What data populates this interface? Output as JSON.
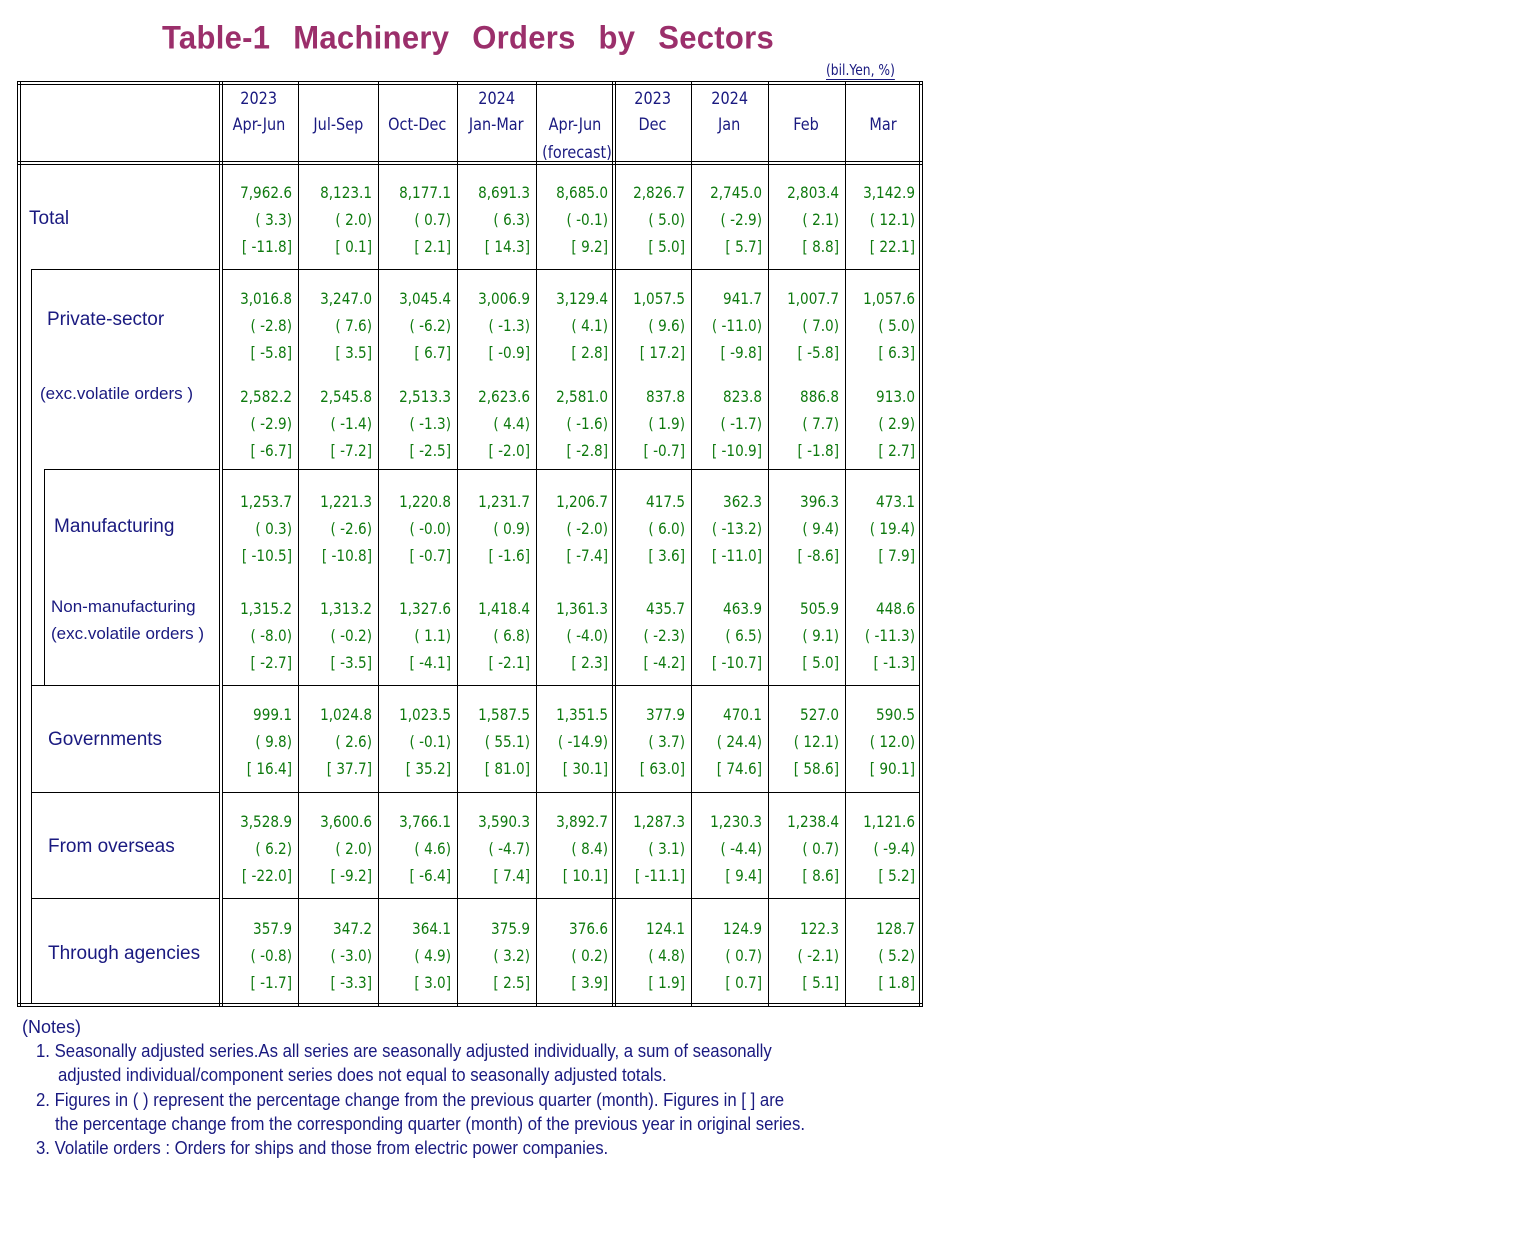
{
  "title": "Table-1  Machinery  Orders  by  Sectors",
  "unit": "(bil.Yen, %)",
  "header": {
    "columns": [
      {
        "year": "2023",
        "period": "Apr-Jun",
        "note": ""
      },
      {
        "year": "",
        "period": "Jul-Sep",
        "note": ""
      },
      {
        "year": "",
        "period": "Oct-Dec",
        "note": ""
      },
      {
        "year": "2024",
        "period": "Jan-Mar",
        "note": ""
      },
      {
        "year": "",
        "period": "Apr-Jun",
        "note": "(forecast)"
      },
      {
        "year": "2023",
        "period": "Dec",
        "note": ""
      },
      {
        "year": "2024",
        "period": "Jan",
        "note": ""
      },
      {
        "year": "",
        "period": "Feb",
        "note": ""
      },
      {
        "year": "",
        "period": "Mar",
        "note": ""
      }
    ]
  },
  "rows": [
    {
      "label": "Total",
      "sublabel": "",
      "values": [
        "7,962.6",
        "8,123.1",
        "8,177.1",
        "8,691.3",
        "8,685.0",
        "2,826.7",
        "2,745.0",
        "2,803.4",
        "3,142.9"
      ],
      "qoq": [
        "( 3.3)",
        "( 2.0)",
        "( 0.7)",
        "( 6.3)",
        "( -0.1)",
        "( 5.0)",
        "( -2.9)",
        "( 2.1)",
        "( 12.1)"
      ],
      "yoy": [
        "[ -11.8]",
        "[ 0.1]",
        "[ 2.1]",
        "[ 14.3]",
        "[ 9.2]",
        "[ 5.0]",
        "[ 5.7]",
        "[ 8.8]",
        "[ 22.1]"
      ]
    },
    {
      "label": "Private-sector",
      "sublabel": "",
      "values": [
        "3,016.8",
        "3,247.0",
        "3,045.4",
        "3,006.9",
        "3,129.4",
        "1,057.5",
        "941.7",
        "1,007.7",
        "1,057.6"
      ],
      "qoq": [
        "( -2.8)",
        "(  7.6)",
        "( -6.2)",
        "( -1.3)",
        "(  4.1)",
        "(  9.6)",
        "( -11.0)",
        "(  7.0)",
        "(  5.0)"
      ],
      "yoy": [
        "[ -5.8]",
        "[  3.5]",
        "[  6.7]",
        "[ -0.9]",
        "[  2.8]",
        "[  17.2]",
        "[ -9.8]",
        "[ -5.8]",
        "[  6.3]"
      ]
    },
    {
      "label": "(exc.volatile orders )",
      "sublabel": "",
      "values": [
        "2,582.2",
        "2,545.8",
        "2,513.3",
        "2,623.6",
        "2,581.0",
        "837.8",
        "823.8",
        "886.8",
        "913.0"
      ],
      "qoq": [
        "( -2.9)",
        "( -1.4)",
        "( -1.3)",
        "( 4.4)",
        "( -1.6)",
        "( 1.9)",
        "( -1.7)",
        "( 7.7)",
        "( 2.9)"
      ],
      "yoy": [
        "[ -6.7]",
        "[ -7.2]",
        "[ -2.5]",
        "[ -2.0]",
        "[ -2.8]",
        "[ -0.7]",
        "[ -10.9]",
        "[ -1.8]",
        "[ 2.7]"
      ]
    },
    {
      "label": "Manufacturing",
      "sublabel": "",
      "values": [
        "1,253.7",
        "1,221.3",
        "1,220.8",
        "1,231.7",
        "1,206.7",
        "417.5",
        "362.3",
        "396.3",
        "473.1"
      ],
      "qoq": [
        "( 0.3)",
        "( -2.6)",
        "( -0.0)",
        "( 0.9)",
        "( -2.0)",
        "( 6.0)",
        "( -13.2)",
        "( 9.4)",
        "( 19.4)"
      ],
      "yoy": [
        "[ -10.5]",
        "[ -10.8]",
        "[ -0.7]",
        "[ -1.6]",
        "[ -7.4]",
        "[ 3.6]",
        "[ -11.0]",
        "[ -8.6]",
        "[ 7.9]"
      ]
    },
    {
      "label": "Non-manufacturing",
      "sublabel": "(exc.volatile orders )",
      "values": [
        "1,315.2",
        "1,313.2",
        "1,327.6",
        "1,418.4",
        "1,361.3",
        "435.7",
        "463.9",
        "505.9",
        "448.6"
      ],
      "qoq": [
        "( -8.0)",
        "( -0.2)",
        "( 1.1)",
        "( 6.8)",
        "( -4.0)",
        "( -2.3)",
        "( 6.5)",
        "( 9.1)",
        "( -11.3)"
      ],
      "yoy": [
        "[ -2.7]",
        "[ -3.5]",
        "[ -4.1]",
        "[ -2.1]",
        "[ 2.3]",
        "[ -4.2]",
        "[ -10.7]",
        "[ 5.0]",
        "[ -1.3]"
      ]
    },
    {
      "label": "Governments",
      "sublabel": "",
      "values": [
        "999.1",
        "1,024.8",
        "1,023.5",
        "1,587.5",
        "1,351.5",
        "377.9",
        "470.1",
        "527.0",
        "590.5"
      ],
      "qoq": [
        "( 9.8)",
        "( 2.6)",
        "( -0.1)",
        "( 55.1)",
        "( -14.9)",
        "( 3.7)",
        "( 24.4)",
        "( 12.1)",
        "( 12.0)"
      ],
      "yoy": [
        "[ 16.4]",
        "[ 37.7]",
        "[ 35.2]",
        "[ 81.0]",
        "[ 30.1]",
        "[ 63.0]",
        "[ 74.6]",
        "[ 58.6]",
        "[ 90.1]"
      ]
    },
    {
      "label": "From overseas",
      "sublabel": "",
      "values": [
        "3,528.9",
        "3,600.6",
        "3,766.1",
        "3,590.3",
        "3,892.7",
        "1,287.3",
        "1,230.3",
        "1,238.4",
        "1,121.6"
      ],
      "qoq": [
        "( 6.2)",
        "( 2.0)",
        "( 4.6)",
        "( -4.7)",
        "( 8.4)",
        "( 3.1)",
        "( -4.4)",
        "( 0.7)",
        "( -9.4)"
      ],
      "yoy": [
        "[ -22.0]",
        "[ -9.2]",
        "[ -6.4]",
        "[ 7.4]",
        "[ 10.1]",
        "[ -11.1]",
        "[ 9.4]",
        "[ 8.6]",
        "[ 5.2]"
      ]
    },
    {
      "label": "Through agencies",
      "sublabel": "",
      "values": [
        "357.9",
        "347.2",
        "364.1",
        "375.9",
        "376.6",
        "124.1",
        "124.9",
        "122.3",
        "128.7"
      ],
      "qoq": [
        "( -0.8)",
        "( -3.0)",
        "( 4.9)",
        "( 3.2)",
        "( 0.2)",
        "( 4.8)",
        "( 0.7)",
        "( -2.1)",
        "( 5.2)"
      ],
      "yoy": [
        "[ -1.7]",
        "[ -3.3]",
        "[ 3.0]",
        "[ 2.5]",
        "[ 3.9]",
        "[ 1.9]",
        "[ 0.7]",
        "[ 5.1]",
        "[ 1.8]"
      ]
    }
  ],
  "notes": {
    "heading": "(Notes)",
    "items": [
      "1. Seasonally adjusted series.As all series are seasonally adjusted individually, a sum of seasonally",
      "adjusted individual/component series does not equal to seasonally adjusted totals.",
      "2. Figures in ( ) represent the percentage change from the previous quarter (month). Figures in [ ] are",
      "the percentage change from the corresponding quarter (month) of the previous year in original series.",
      "3. Volatile orders : Orders for ships and those from electric power companies."
    ]
  }
}
